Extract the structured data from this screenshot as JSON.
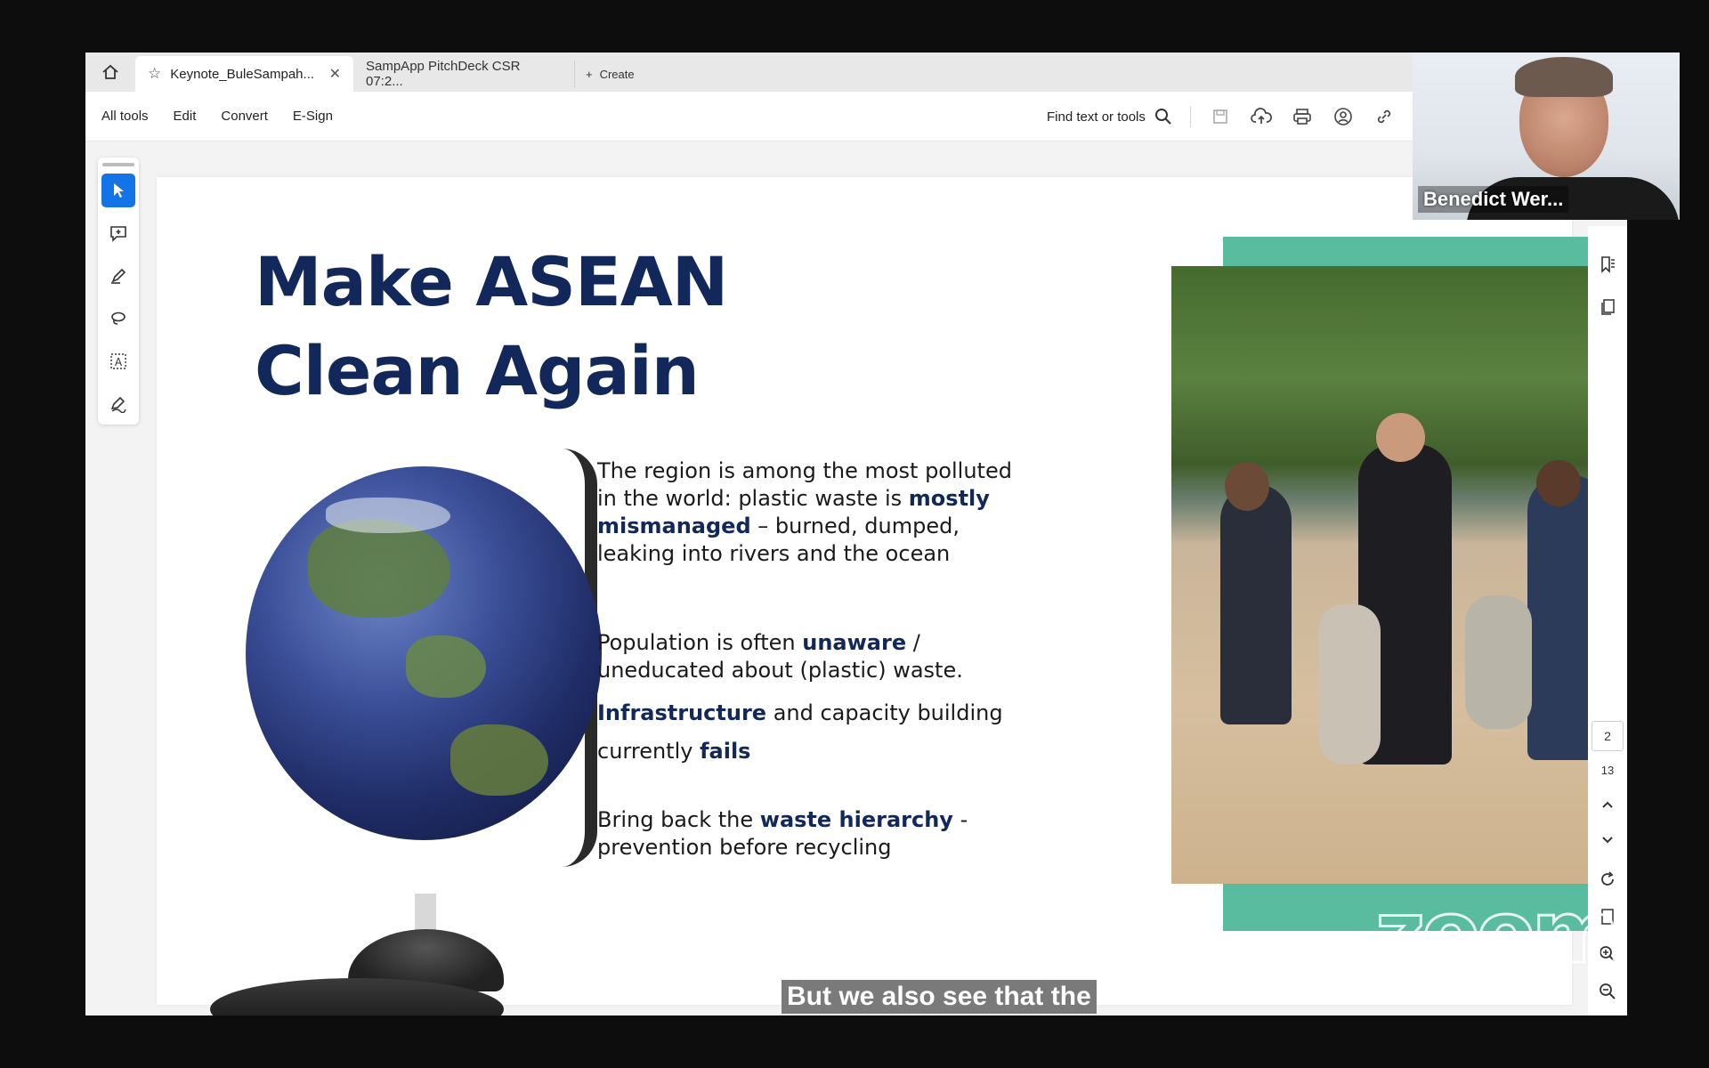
{
  "tabs": {
    "active_label": "Keynote_BuleSampah...",
    "inactive_label": "SampApp PitchDeck CSR 07:2...",
    "create_label": "Create"
  },
  "toolbar": {
    "menu": [
      "All tools",
      "Edit",
      "Convert",
      "E-Sign"
    ],
    "find_label": "Find text or tools"
  },
  "slide": {
    "title_line1": "Make ASEAN",
    "title_line2": "Clean Again",
    "p1_a": "The region is among the most polluted in the world: plastic waste is ",
    "p1_b": "mostly mismanaged",
    "p1_c": " – burned, dumped, leaking into rivers and the ocean",
    "p2_a": "Population is often ",
    "p2_b": "unaware",
    "p2_c": " / uneducated about (plastic) waste.",
    "p3_a": "Infrastructure",
    "p3_b": " and capacity building currently ",
    "p3_c": "fails",
    "p4_a": "Bring back the ",
    "p4_b": "waste hierarchy",
    "p4_c": " - prevention before recycling"
  },
  "caption": "But we also see that the",
  "page_nav": {
    "current": "2",
    "total": "13"
  },
  "webcam": {
    "name": "Benedict Wer..."
  },
  "watermark": "zoom",
  "colors": {
    "title": "#13285a",
    "teal_frame": "#5abc9f",
    "active_tool": "#1473e6"
  }
}
